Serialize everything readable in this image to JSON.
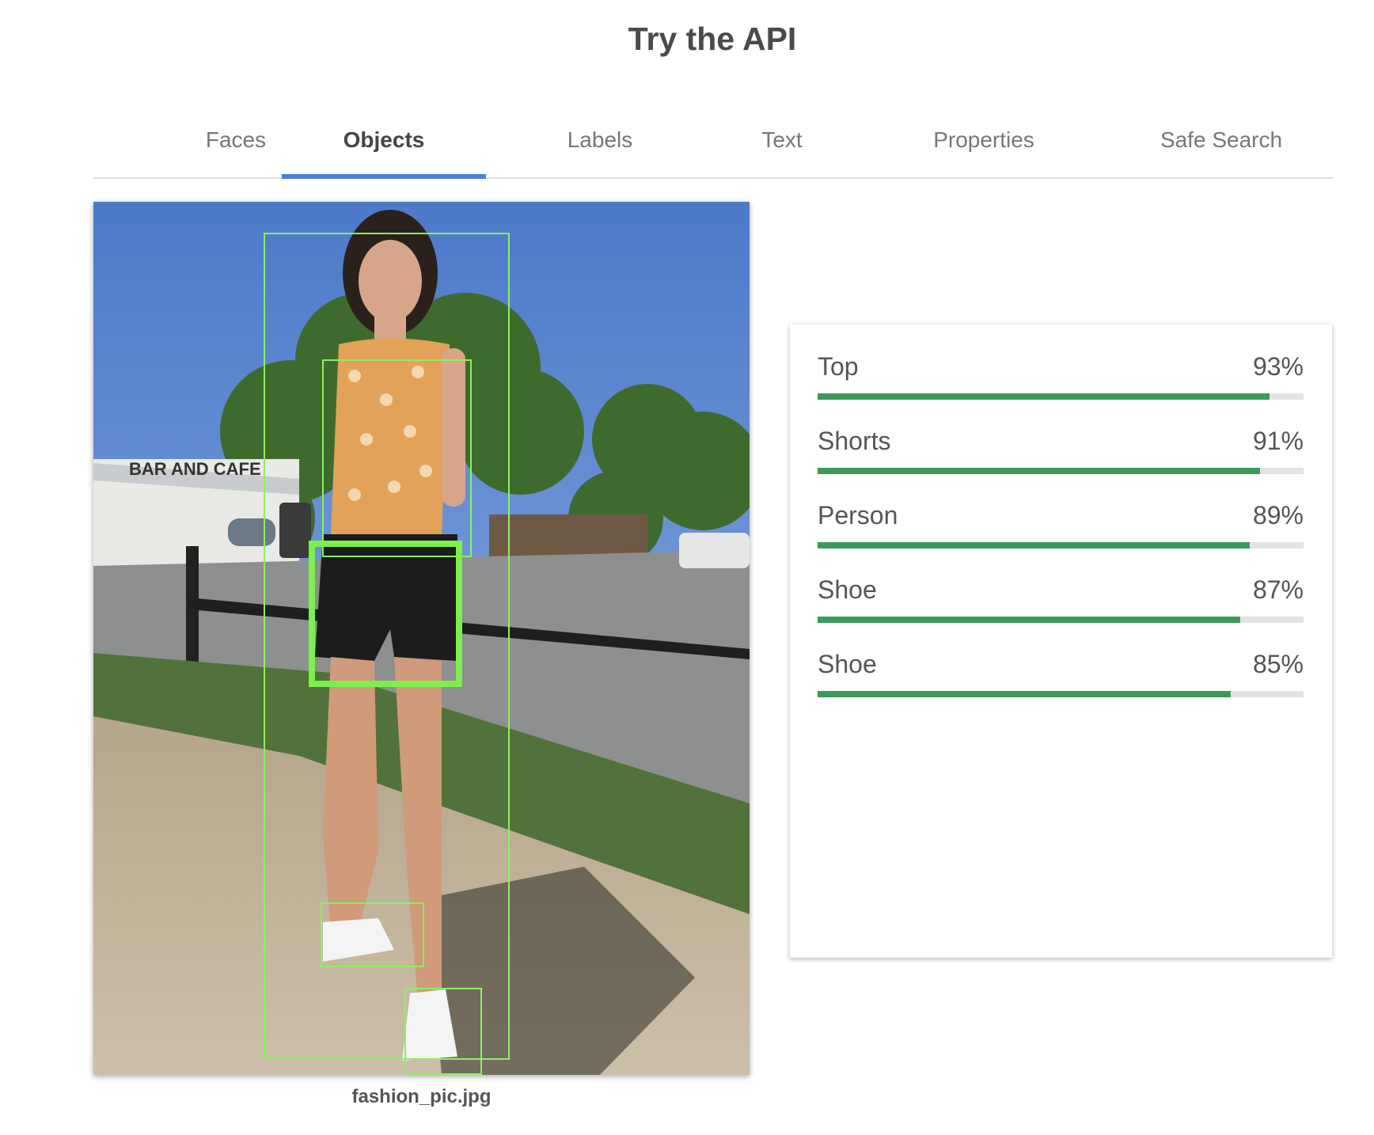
{
  "page": {
    "title": "Try the API"
  },
  "tabs": [
    {
      "label": "Faces",
      "active": false
    },
    {
      "label": "Objects",
      "active": true
    },
    {
      "label": "Labels",
      "active": false
    },
    {
      "label": "Text",
      "active": false
    },
    {
      "label": "Properties",
      "active": false
    },
    {
      "label": "Safe Search",
      "active": false
    }
  ],
  "image": {
    "filename": "fashion_pic.jpg",
    "sign_text": "BAR AND CAFE"
  },
  "results": [
    {
      "name": "Top",
      "score": "93%",
      "value": 0.93
    },
    {
      "name": "Shorts",
      "score": "91%",
      "value": 0.91
    },
    {
      "name": "Person",
      "score": "89%",
      "value": 0.89
    },
    {
      "name": "Shoe",
      "score": "87%",
      "value": 0.87
    },
    {
      "name": "Shoe",
      "score": "85%",
      "value": 0.85
    }
  ],
  "colors": {
    "accent": "#4a7fe0",
    "bar_fill": "#3b9a5a",
    "bar_track": "#e3e3e3",
    "bbox": "#8cf060"
  }
}
